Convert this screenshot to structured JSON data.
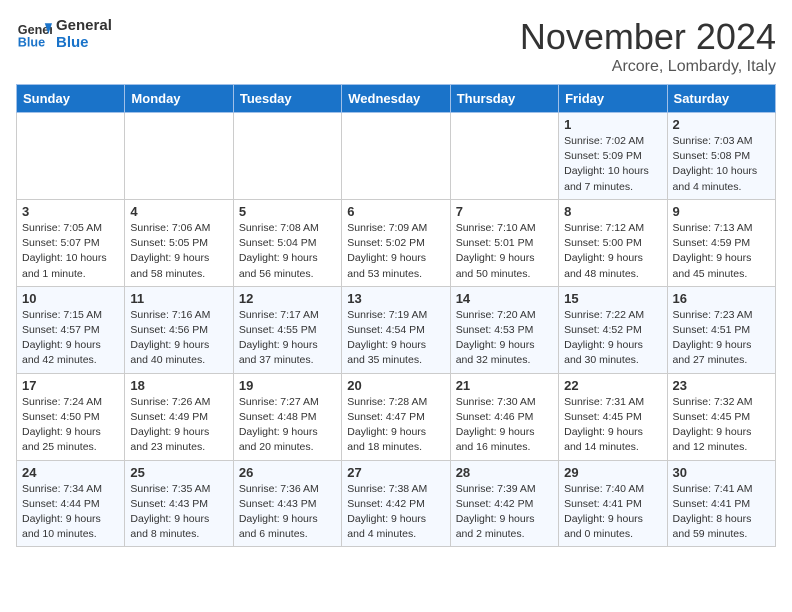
{
  "header": {
    "logo_line1": "General",
    "logo_line2": "Blue",
    "month": "November 2024",
    "location": "Arcore, Lombardy, Italy"
  },
  "weekdays": [
    "Sunday",
    "Monday",
    "Tuesday",
    "Wednesday",
    "Thursday",
    "Friday",
    "Saturday"
  ],
  "weeks": [
    [
      {
        "day": "",
        "detail": ""
      },
      {
        "day": "",
        "detail": ""
      },
      {
        "day": "",
        "detail": ""
      },
      {
        "day": "",
        "detail": ""
      },
      {
        "day": "",
        "detail": ""
      },
      {
        "day": "1",
        "detail": "Sunrise: 7:02 AM\nSunset: 5:09 PM\nDaylight: 10 hours\nand 7 minutes."
      },
      {
        "day": "2",
        "detail": "Sunrise: 7:03 AM\nSunset: 5:08 PM\nDaylight: 10 hours\nand 4 minutes."
      }
    ],
    [
      {
        "day": "3",
        "detail": "Sunrise: 7:05 AM\nSunset: 5:07 PM\nDaylight: 10 hours\nand 1 minute."
      },
      {
        "day": "4",
        "detail": "Sunrise: 7:06 AM\nSunset: 5:05 PM\nDaylight: 9 hours\nand 58 minutes."
      },
      {
        "day": "5",
        "detail": "Sunrise: 7:08 AM\nSunset: 5:04 PM\nDaylight: 9 hours\nand 56 minutes."
      },
      {
        "day": "6",
        "detail": "Sunrise: 7:09 AM\nSunset: 5:02 PM\nDaylight: 9 hours\nand 53 minutes."
      },
      {
        "day": "7",
        "detail": "Sunrise: 7:10 AM\nSunset: 5:01 PM\nDaylight: 9 hours\nand 50 minutes."
      },
      {
        "day": "8",
        "detail": "Sunrise: 7:12 AM\nSunset: 5:00 PM\nDaylight: 9 hours\nand 48 minutes."
      },
      {
        "day": "9",
        "detail": "Sunrise: 7:13 AM\nSunset: 4:59 PM\nDaylight: 9 hours\nand 45 minutes."
      }
    ],
    [
      {
        "day": "10",
        "detail": "Sunrise: 7:15 AM\nSunset: 4:57 PM\nDaylight: 9 hours\nand 42 minutes."
      },
      {
        "day": "11",
        "detail": "Sunrise: 7:16 AM\nSunset: 4:56 PM\nDaylight: 9 hours\nand 40 minutes."
      },
      {
        "day": "12",
        "detail": "Sunrise: 7:17 AM\nSunset: 4:55 PM\nDaylight: 9 hours\nand 37 minutes."
      },
      {
        "day": "13",
        "detail": "Sunrise: 7:19 AM\nSunset: 4:54 PM\nDaylight: 9 hours\nand 35 minutes."
      },
      {
        "day": "14",
        "detail": "Sunrise: 7:20 AM\nSunset: 4:53 PM\nDaylight: 9 hours\nand 32 minutes."
      },
      {
        "day": "15",
        "detail": "Sunrise: 7:22 AM\nSunset: 4:52 PM\nDaylight: 9 hours\nand 30 minutes."
      },
      {
        "day": "16",
        "detail": "Sunrise: 7:23 AM\nSunset: 4:51 PM\nDaylight: 9 hours\nand 27 minutes."
      }
    ],
    [
      {
        "day": "17",
        "detail": "Sunrise: 7:24 AM\nSunset: 4:50 PM\nDaylight: 9 hours\nand 25 minutes."
      },
      {
        "day": "18",
        "detail": "Sunrise: 7:26 AM\nSunset: 4:49 PM\nDaylight: 9 hours\nand 23 minutes."
      },
      {
        "day": "19",
        "detail": "Sunrise: 7:27 AM\nSunset: 4:48 PM\nDaylight: 9 hours\nand 20 minutes."
      },
      {
        "day": "20",
        "detail": "Sunrise: 7:28 AM\nSunset: 4:47 PM\nDaylight: 9 hours\nand 18 minutes."
      },
      {
        "day": "21",
        "detail": "Sunrise: 7:30 AM\nSunset: 4:46 PM\nDaylight: 9 hours\nand 16 minutes."
      },
      {
        "day": "22",
        "detail": "Sunrise: 7:31 AM\nSunset: 4:45 PM\nDaylight: 9 hours\nand 14 minutes."
      },
      {
        "day": "23",
        "detail": "Sunrise: 7:32 AM\nSunset: 4:45 PM\nDaylight: 9 hours\nand 12 minutes."
      }
    ],
    [
      {
        "day": "24",
        "detail": "Sunrise: 7:34 AM\nSunset: 4:44 PM\nDaylight: 9 hours\nand 10 minutes."
      },
      {
        "day": "25",
        "detail": "Sunrise: 7:35 AM\nSunset: 4:43 PM\nDaylight: 9 hours\nand 8 minutes."
      },
      {
        "day": "26",
        "detail": "Sunrise: 7:36 AM\nSunset: 4:43 PM\nDaylight: 9 hours\nand 6 minutes."
      },
      {
        "day": "27",
        "detail": "Sunrise: 7:38 AM\nSunset: 4:42 PM\nDaylight: 9 hours\nand 4 minutes."
      },
      {
        "day": "28",
        "detail": "Sunrise: 7:39 AM\nSunset: 4:42 PM\nDaylight: 9 hours\nand 2 minutes."
      },
      {
        "day": "29",
        "detail": "Sunrise: 7:40 AM\nSunset: 4:41 PM\nDaylight: 9 hours\nand 0 minutes."
      },
      {
        "day": "30",
        "detail": "Sunrise: 7:41 AM\nSunset: 4:41 PM\nDaylight: 8 hours\nand 59 minutes."
      }
    ]
  ]
}
